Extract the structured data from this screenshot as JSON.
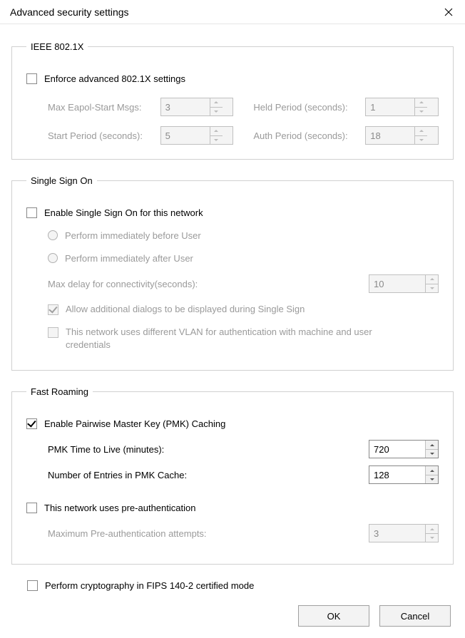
{
  "window": {
    "title": "Advanced security settings"
  },
  "ieee8021x": {
    "legend": "IEEE 802.1X",
    "enforce_label": "Enforce advanced 802.1X settings",
    "max_eapol_label": "Max Eapol-Start Msgs:",
    "max_eapol_value": "3",
    "held_period_label": "Held Period (seconds):",
    "held_period_value": "1",
    "start_period_label": "Start Period (seconds):",
    "start_period_value": "5",
    "auth_period_label": "Auth Period (seconds):",
    "auth_period_value": "18"
  },
  "sso": {
    "legend": "Single Sign On",
    "enable_label": "Enable Single Sign On for this network",
    "before_label": "Perform immediately before User",
    "after_label": "Perform immediately after User",
    "max_delay_label": "Max delay for connectivity(seconds):",
    "max_delay_value": "10",
    "allow_dialogs_label": "Allow additional dialogs to be displayed during Single Sign",
    "vlan_label": "This network uses different VLAN for authentication with machine and user credentials"
  },
  "fast_roaming": {
    "legend": "Fast Roaming",
    "enable_pmk_label": "Enable Pairwise Master Key (PMK) Caching",
    "pmk_ttl_label": "PMK Time to Live (minutes):",
    "pmk_ttl_value": "720",
    "pmk_entries_label": "Number of Entries in PMK Cache:",
    "pmk_entries_value": "128",
    "preauth_label": "This network uses pre-authentication",
    "max_preauth_label": "Maximum Pre-authentication attempts:",
    "max_preauth_value": "3"
  },
  "fips": {
    "label": "Perform cryptography in FIPS 140-2 certified mode"
  },
  "buttons": {
    "ok": "OK",
    "cancel": "Cancel"
  }
}
